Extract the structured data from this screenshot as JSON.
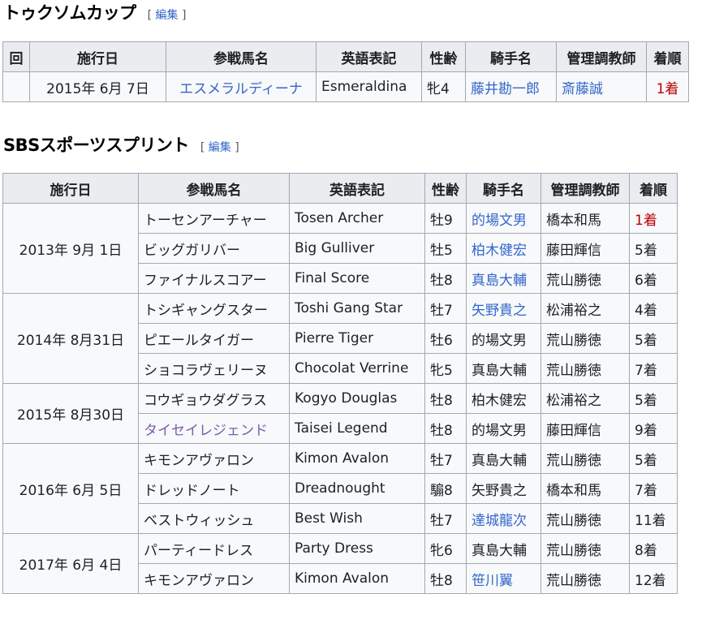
{
  "tokusomu": {
    "title": "トゥクソムカップ",
    "edit_open": "[ ",
    "edit_label": "編集",
    "edit_close": " ]",
    "headers": [
      "回",
      "施行日",
      "参戦馬名",
      "英語表記",
      "性齢",
      "騎手名",
      "管理調教師",
      "着順"
    ],
    "rows": [
      {
        "round": "",
        "date": "2015年 6月 7日",
        "horse": "エスメラルディーナ",
        "english": "Esmeraldina",
        "sex_age": "牝4",
        "jockey": "藤井勘一郎",
        "trainer": "斎藤誠",
        "finish": "1着"
      }
    ]
  },
  "sbs": {
    "title": "SBSスポーツスプリント",
    "edit_open": "[ ",
    "edit_label": "編集",
    "edit_close": " ]",
    "headers": [
      "施行日",
      "参戦馬名",
      "英語表記",
      "性齢",
      "騎手名",
      "管理調教師",
      "着順"
    ],
    "rows": [
      {
        "date": "2013年 9月 1日",
        "horse": "トーセンアーチャー",
        "english": "Tosen Archer",
        "sex_age": "牡9",
        "jockey": "的場文男",
        "trainer": "橋本和馬",
        "finish": "1着"
      },
      {
        "horse": "ビッグガリバー",
        "english": "Big Gulliver",
        "sex_age": "牡5",
        "jockey": "柏木健宏",
        "trainer": "藤田輝信",
        "finish": "5着"
      },
      {
        "horse": "ファイナルスコアー",
        "english": "Final Score",
        "sex_age": "牡8",
        "jockey": "真島大輔",
        "trainer": "荒山勝徳",
        "finish": "6着"
      },
      {
        "date": "2014年 8月31日",
        "horse": "トシギャングスター",
        "english": "Toshi Gang Star",
        "sex_age": "牡7",
        "jockey": "矢野貴之",
        "trainer": "松浦裕之",
        "finish": "4着"
      },
      {
        "horse": "ピエールタイガー",
        "english": "Pierre Tiger",
        "sex_age": "牡6",
        "jockey": "的場文男",
        "trainer": "荒山勝徳",
        "finish": "5着"
      },
      {
        "horse": "ショコラヴェリーヌ",
        "english": "Chocolat Verrine",
        "sex_age": "牝5",
        "jockey": "真島大輔",
        "trainer": "荒山勝徳",
        "finish": "7着"
      },
      {
        "date": "2015年 8月30日",
        "horse": "コウギョウダグラス",
        "english": "Kogyo Douglas",
        "sex_age": "牡8",
        "jockey": "柏木健宏",
        "trainer": "松浦裕之",
        "finish": "5着"
      },
      {
        "horse": "タイセイレジェンド",
        "english": "Taisei Legend",
        "sex_age": "牡8",
        "jockey": "的場文男",
        "trainer": "藤田輝信",
        "finish": "9着"
      },
      {
        "date": "2016年 6月 5日",
        "horse": "キモンアヴァロン",
        "english": "Kimon Avalon",
        "sex_age": "牡7",
        "jockey": "真島大輔",
        "trainer": "荒山勝徳",
        "finish": "5着"
      },
      {
        "horse": "ドレッドノート",
        "english": "Dreadnought",
        "sex_age": "騸8",
        "jockey": "矢野貴之",
        "trainer": "橋本和馬",
        "finish": "7着"
      },
      {
        "horse": "ベストウィッシュ",
        "english": "Best Wish",
        "sex_age": "牡7",
        "jockey": "達城龍次",
        "trainer": "荒山勝徳",
        "finish": "11着"
      },
      {
        "date": "2017年 6月 4日",
        "horse": "パーティードレス",
        "english": "Party Dress",
        "sex_age": "牝6",
        "jockey": "真島大輔",
        "trainer": "荒山勝徳",
        "finish": "8着"
      },
      {
        "horse": "キモンアヴァロン",
        "english": "Kimon Avalon",
        "sex_age": "牡8",
        "jockey": "笹川翼",
        "trainer": "荒山勝徳",
        "finish": "12着"
      }
    ]
  },
  "colors": {
    "link": "#3366cc",
    "visited_link": "#795cb2",
    "win": "#ba0000",
    "header_bg": "#eaecf0",
    "cell_bg": "#f8f9fa",
    "border": "#a2a9b1"
  }
}
